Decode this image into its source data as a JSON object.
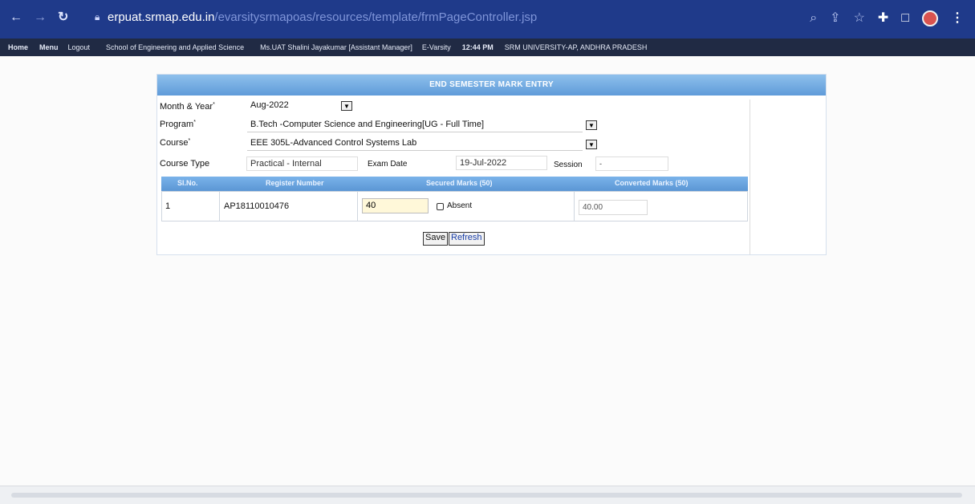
{
  "browser": {
    "url_domain": "erpuat.srmap.edu.in",
    "url_path": "/evarsitysrmapoas/resources/template/frmPageController.jsp",
    "icons": [
      "back-arrow-icon",
      "forward-arrow-icon",
      "reload-icon",
      "lock-icon",
      "zoom-icon",
      "share-icon",
      "star-icon",
      "extension-icon",
      "sidebar-icon",
      "profile-avatar-icon",
      "kebab-menu-icon"
    ]
  },
  "menubar": {
    "home": "Home",
    "menu": "Menu",
    "logout": "Logout",
    "school": "School of Engineering and Applied Science",
    "user": "Ms.UAT Shalini Jayakumar [Assistant Manager]",
    "module": "E-Varsity",
    "time": "12:44 PM",
    "university": "SRM UNIVERSITY-AP, ANDHRA PRADESH"
  },
  "form": {
    "title": "END SEMESTER MARK ENTRY",
    "month_year_label": "Month & Year",
    "month_year_value": "Aug-2022",
    "program_label": "Program",
    "program_value": "B.Tech -Computer Science and Engineering[UG - Full Time]",
    "course_label": "Course",
    "course_value": "EEE 305L-Advanced Control Systems Lab",
    "course_type_label": "Course Type",
    "course_type_value": "Practical - Internal",
    "exam_date_label": "Exam Date",
    "exam_date_value": "19-Jul-2022",
    "session_label": "Session",
    "session_value": "-",
    "required_mark": "*"
  },
  "table": {
    "headers": [
      "Sl.No.",
      "Register Number",
      "Secured Marks (50)",
      "Converted Marks (50)"
    ],
    "rows": [
      {
        "slno": "1",
        "register": "AP18110010476",
        "marks": "40",
        "absent_label": "Absent",
        "converted": "40.00"
      }
    ]
  },
  "actions": {
    "save": "Save",
    "refresh": "Refresh"
  },
  "colors": {
    "browser_blue": "#1f3a8a",
    "menu_dark": "#202a44",
    "panel_header": "#5f9bd9"
  }
}
